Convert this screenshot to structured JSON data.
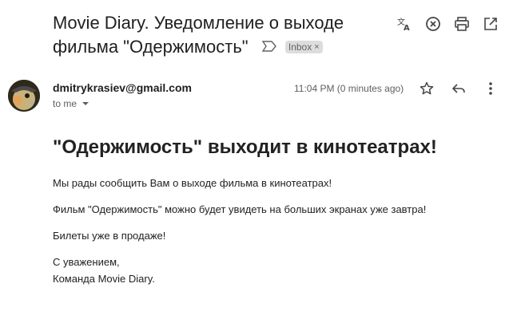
{
  "header": {
    "subject_line1": "Movie Diary. Уведомление о выходе",
    "subject_line2": "фильма \"Одержимость\"",
    "label_chip": "Inbox",
    "label_chip_close": "×",
    "actions": [
      {
        "name": "translate-icon"
      },
      {
        "name": "close-circle-icon"
      },
      {
        "name": "print-icon"
      },
      {
        "name": "open-in-new-window-icon"
      }
    ]
  },
  "message": {
    "sender": "dmitrykrasiev@gmail.com",
    "recipient": "to me",
    "timestamp": "11:04 PM (0 minutes ago)",
    "actions": [
      {
        "name": "star-icon"
      },
      {
        "name": "reply-icon"
      },
      {
        "name": "more-options-icon"
      }
    ]
  },
  "body": {
    "heading": "\"Одержимость\" выходит в кинотеатрах!",
    "paragraphs": [
      "Мы рады сообщить Вам о выходе фильма в кинотеатрах!",
      "Фильм \"Одержимость\" можно будет увидеть на больших экранах уже завтра!",
      "Билеты уже в продаже!"
    ],
    "signoff_line1": "С уважением,",
    "signoff_line2": "Команда Movie Diary."
  },
  "colors": {
    "text": "#202124",
    "muted": "#5e5e5e",
    "chip_bg": "#dddddd"
  }
}
